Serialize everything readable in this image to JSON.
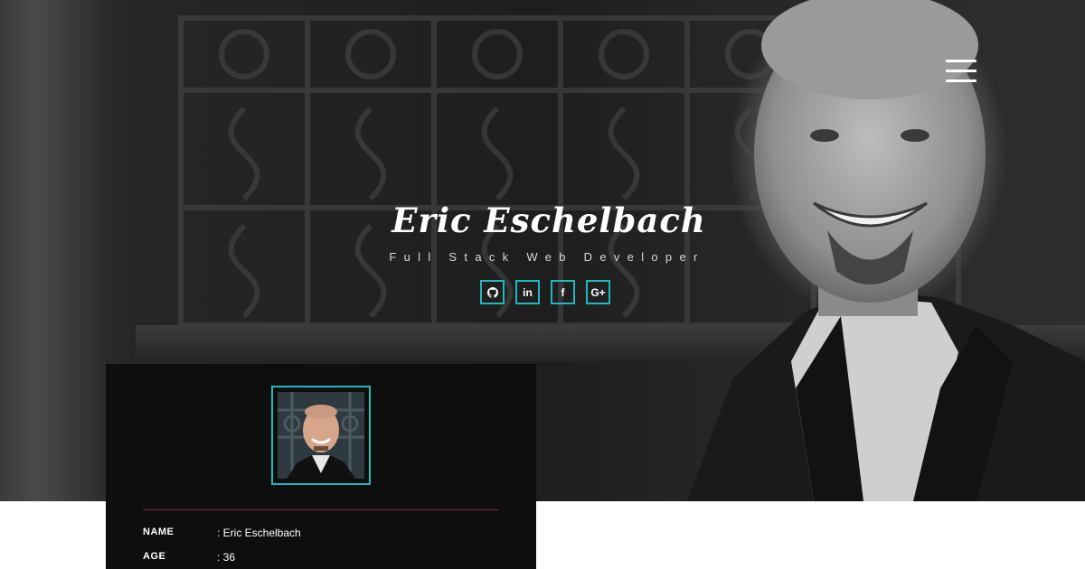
{
  "hero": {
    "name": "Eric Eschelbach",
    "role": "Full Stack Web Developer",
    "menu_icon": "hamburger-menu-icon"
  },
  "socials": [
    {
      "network": "github",
      "glyph": "⚉"
    },
    {
      "network": "linkedin",
      "glyph": "in"
    },
    {
      "network": "facebook",
      "glyph": "f"
    },
    {
      "network": "google-plus",
      "glyph": "G+"
    }
  ],
  "colors": {
    "accent": "#21b8bd",
    "divider": "#9b1e3a",
    "card_bg": "#0e0e0f"
  },
  "profile": {
    "rows": [
      {
        "label": "NAME",
        "value": ": Eric Eschelbach"
      },
      {
        "label": "AGE",
        "value": ": 36"
      }
    ]
  }
}
